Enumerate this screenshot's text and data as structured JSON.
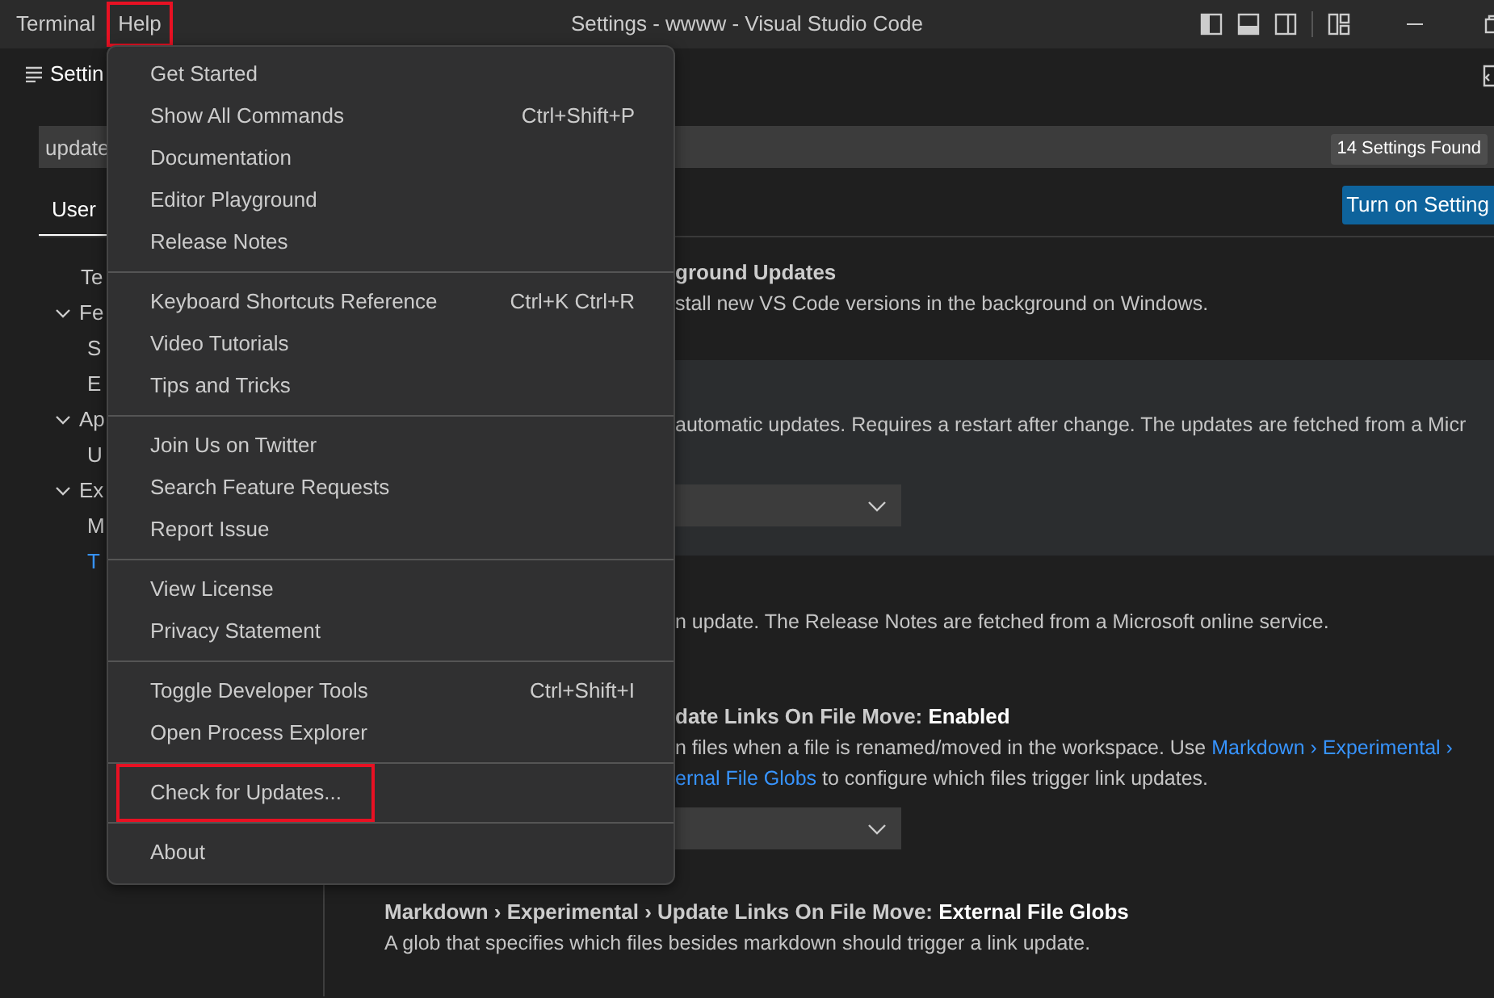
{
  "titlebar": {
    "menus": [
      {
        "label": "Terminal",
        "highlighted": false
      },
      {
        "label": "Help",
        "highlighted": true
      }
    ],
    "title": "Settings - wwww - Visual Studio Code"
  },
  "editor_tab": {
    "label": "Settin"
  },
  "search": {
    "value": "update",
    "result_count": "14 Settings Found"
  },
  "scope_tabs": [
    {
      "label": "User",
      "selected": true
    }
  ],
  "turn_on_button": "Turn on Setting",
  "toc": [
    {
      "label": "Te",
      "selected": false
    },
    {
      "label": "Fe",
      "expanded": true,
      "selected": false,
      "children": [
        {
          "label": "S",
          "selected": false
        },
        {
          "label": "E",
          "selected": false
        }
      ]
    },
    {
      "label": "Ap",
      "expanded": true,
      "selected": false,
      "children": [
        {
          "label": "U",
          "selected": false
        }
      ]
    },
    {
      "label": "Ex",
      "expanded": true,
      "selected": false,
      "children": [
        {
          "label": "M",
          "selected": false
        },
        {
          "label": "T",
          "selected": true
        }
      ]
    }
  ],
  "settings": [
    {
      "covered": true,
      "focused": false,
      "title": "ground Updates",
      "description": [
        [
          {
            "text": "stall new VS Code versions in the background on Windows.",
            "link": false
          }
        ]
      ]
    },
    {
      "covered": true,
      "focused": true,
      "description": [
        [
          {
            "text": "automatic updates. Requires a restart after change. The updates are fetched from a Micr",
            "link": false
          }
        ]
      ],
      "control": {
        "kind": "dropdown"
      }
    },
    {
      "covered": true,
      "focused": false,
      "description": [
        [
          {
            "text": "n update. The Release Notes are fetched from a Microsoft online service.",
            "link": false
          }
        ]
      ]
    },
    {
      "covered": true,
      "focused": false,
      "title": "date Links On File Move: **Enabled**",
      "description": [
        [
          {
            "text": "n files when a file is renamed/moved in the workspace. Use ",
            "link": false
          },
          {
            "text": "Markdown › Experimental ›",
            "link": true
          }
        ],
        [
          {
            "text": "ernal File Globs",
            "link": true
          },
          {
            "text": " to configure which files trigger link updates.",
            "link": false
          }
        ]
      ],
      "control": {
        "kind": "dropdown"
      }
    },
    {
      "covered": false,
      "focused": false,
      "title": "Markdown › Experimental › Update Links On File Move: **External File Globs**",
      "description": [
        [
          {
            "text": "A glob that specifies which files besides markdown should trigger a link update.",
            "link": false
          }
        ]
      ]
    }
  ],
  "help_menu": {
    "groups": [
      [
        {
          "label": "Get Started",
          "highlighted": false
        },
        {
          "label": "Show All Commands",
          "shortcut": "Ctrl+Shift+P",
          "highlighted": false
        },
        {
          "label": "Documentation",
          "highlighted": false
        },
        {
          "label": "Editor Playground",
          "highlighted": false
        },
        {
          "label": "Release Notes",
          "highlighted": false
        }
      ],
      [
        {
          "label": "Keyboard Shortcuts Reference",
          "shortcut": "Ctrl+K Ctrl+R",
          "highlighted": false
        },
        {
          "label": "Video Tutorials",
          "highlighted": false
        },
        {
          "label": "Tips and Tricks",
          "highlighted": false
        }
      ],
      [
        {
          "label": "Join Us on Twitter",
          "highlighted": false
        },
        {
          "label": "Search Feature Requests",
          "highlighted": false
        },
        {
          "label": "Report Issue",
          "highlighted": false
        }
      ],
      [
        {
          "label": "View License",
          "highlighted": false
        },
        {
          "label": "Privacy Statement",
          "highlighted": false
        }
      ],
      [
        {
          "label": "Toggle Developer Tools",
          "shortcut": "Ctrl+Shift+I",
          "highlighted": false
        },
        {
          "label": "Open Process Explorer",
          "highlighted": false
        }
      ],
      [
        {
          "label": "Check for Updates...",
          "highlighted": true
        }
      ],
      [
        {
          "label": "About",
          "highlighted": false
        }
      ]
    ]
  }
}
